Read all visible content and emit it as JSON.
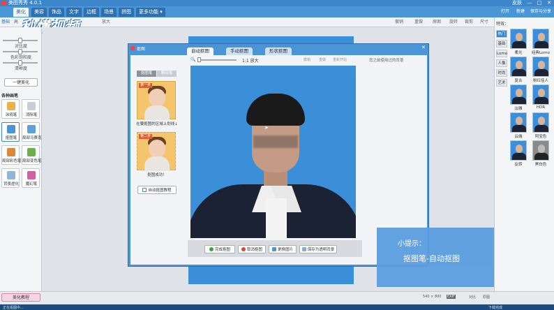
{
  "app": {
    "title": "美图秀秀 4.0.1"
  },
  "window_controls": {
    "skin": "皮肤",
    "min": "—",
    "max": "□",
    "close": "✕"
  },
  "menu": {
    "tabs": [
      "美化",
      "美容",
      "饰品",
      "文字",
      "边框",
      "场景",
      "拼图",
      "更多功能 ▾"
    ],
    "active": "美化",
    "right": {
      "open": "打开",
      "new": "新建",
      "save": "保存与分享"
    }
  },
  "watermark": "秒懂视频",
  "toolbar": {
    "left_items": [
      "基础",
      "高"
    ],
    "zoom_label": "放大",
    "right_items": [
      "撤销",
      "重做",
      "原图",
      "旋转",
      "裁剪",
      "尺寸"
    ]
  },
  "left_panel": {
    "sliders": [
      {
        "label": "对比度",
        "value": 0.5
      },
      {
        "label": "色彩饱和度",
        "value": 0.5
      },
      {
        "label": "清晰度",
        "value": 0.5
      }
    ],
    "one_click_button": "一键美化",
    "section_title": "各种画笔",
    "tools": [
      "涂鸦笔",
      "消除笔",
      "抠图笔",
      "局部马赛克",
      "局部彩色笔",
      "局部变色笔",
      "背景虚化",
      "魔幻笔"
    ],
    "bottom_button": "美化教程"
  },
  "right_panel": {
    "header": "特效：",
    "tabs": [
      "热门",
      "基础",
      "Lomo",
      "人像",
      "时尚",
      "艺术"
    ],
    "active_tab": "热门",
    "effects": [
      "柔光",
      "经典Lomo",
      "复古",
      "粉红佳人",
      "淡雅",
      "HDR",
      "云端",
      "阿宝色",
      "反转",
      "黑白色"
    ]
  },
  "dialog": {
    "title": "抠图",
    "tabs": [
      "自动抠图",
      "手动抠图",
      "形状抠图"
    ],
    "active_tab": "自动抠图",
    "subtabs": [
      "抠图笔",
      "删除笔"
    ],
    "card1_tag": "第一步",
    "card1_caption": "在要抠图的区域上划线↓",
    "card2_tag": "第二步",
    "card2_caption": "抠图成功！",
    "tutorial_button": "自动抠图教程",
    "zoom_text": "1:1 放大",
    "toolbar_right": [
      "撤销",
      "重做",
      "重新开始"
    ],
    "hint_text": "您之前使用过的背景",
    "buttons": [
      "完成抠图",
      "取消抠图",
      "更换图片",
      "保存为透明背景"
    ]
  },
  "hint": {
    "title": "小提示：",
    "body": "抠图笔-自动抠图"
  },
  "status": {
    "size": "540 × 800",
    "exif": "EXIF",
    "compare": "对比",
    "original": "原图"
  },
  "taskbar": {
    "left": "正在抠图中...",
    "right": "下载完成"
  }
}
